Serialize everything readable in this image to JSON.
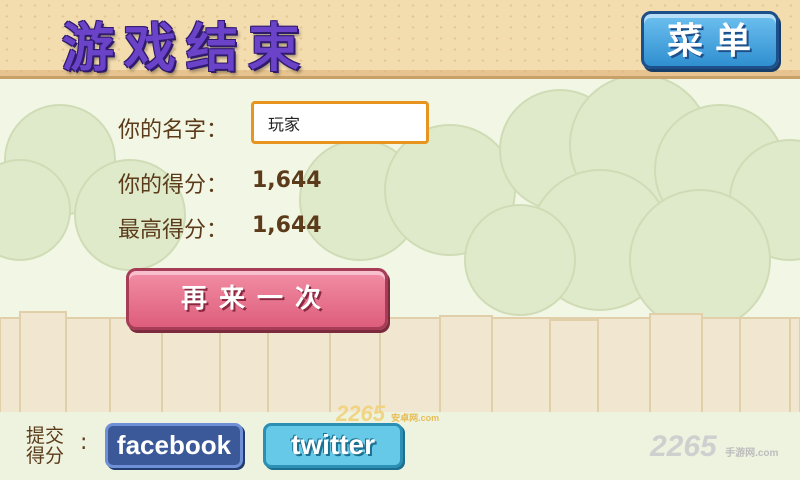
{
  "header": {
    "title": "游戏结束",
    "menu_label": "菜单"
  },
  "form": {
    "name_label": "你的名字：",
    "name_value": "玩家",
    "score_label": "你的得分：",
    "score_value": "1,644",
    "best_label": "最高得分：",
    "best_value": "1,644"
  },
  "actions": {
    "retry_label": "再来一次"
  },
  "social": {
    "submit_label_line1": "提交",
    "submit_label_line2": "得分",
    "colon": ":",
    "facebook_label": "facebook",
    "twitter_label": "twitter"
  },
  "watermarks": {
    "center": "2265",
    "center_sub": "安卓网.com",
    "right": "2265",
    "right_sub": "手游网.com"
  },
  "colors": {
    "title": "#6a43c9",
    "menu": "#2f8fd0",
    "retry": "#de5e7c",
    "facebook": "#3b5998",
    "twitter": "#65c9e7",
    "input_border": "#e8951f"
  }
}
